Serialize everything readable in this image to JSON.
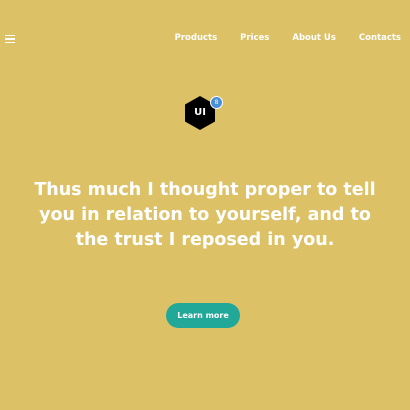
{
  "header": {
    "menu_icon": "hamburger-menu-icon",
    "nav_items": [
      {
        "label": "Products"
      },
      {
        "label": "Prices"
      },
      {
        "label": "About Us"
      },
      {
        "label": "Contacts"
      }
    ]
  },
  "logo": {
    "text": "UI",
    "badge": "8"
  },
  "hero": {
    "headline": "Thus much I thought proper to tell you in relation to yourself, and to the trust I reposed in you.",
    "cta_label": "Learn more"
  },
  "colors": {
    "background": "#dcc167",
    "logo": "#000000",
    "badge": "#4a90d9",
    "button": "#22a898",
    "text": "#ffffff"
  }
}
